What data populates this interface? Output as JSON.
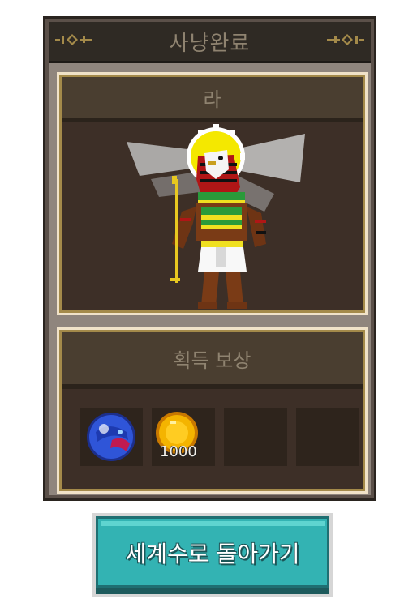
{
  "dialog": {
    "title": "사냥완료"
  },
  "monster": {
    "name": "라"
  },
  "rewards": {
    "header": "획득 보상",
    "slots": [
      {
        "icon": "blue-orb-icon",
        "quantity": ""
      },
      {
        "icon": "gold-coin-icon",
        "quantity": "1000"
      },
      {
        "icon": "",
        "quantity": ""
      },
      {
        "icon": "",
        "quantity": ""
      }
    ]
  },
  "button": {
    "label": "세계수로 돌아가기"
  },
  "colors": {
    "accent": "#33b3b3",
    "frame_gold": "#a48a4a",
    "panel_dark": "#3d2f27"
  }
}
